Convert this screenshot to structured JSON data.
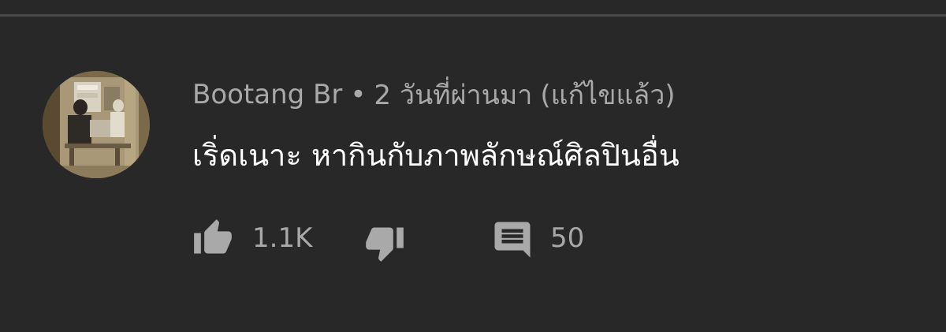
{
  "comment": {
    "author": "Bootang Br",
    "separator": "•",
    "time": "2 วันที่ผ่านมา",
    "edited_label": "(แก้ไขแล้ว)",
    "text": "เริ่ดเนาะ หากินกับภาพลักษณ์ศิลปินอื่น"
  },
  "actions": {
    "like_count": "1.1K",
    "reply_count": "50"
  },
  "icons": {
    "like": "thumbs-up-icon",
    "dislike": "thumbs-down-icon",
    "reply": "comment-icon"
  },
  "colors": {
    "background": "#282828",
    "text_primary": "#ffffff",
    "text_secondary": "#a9a9a9"
  }
}
